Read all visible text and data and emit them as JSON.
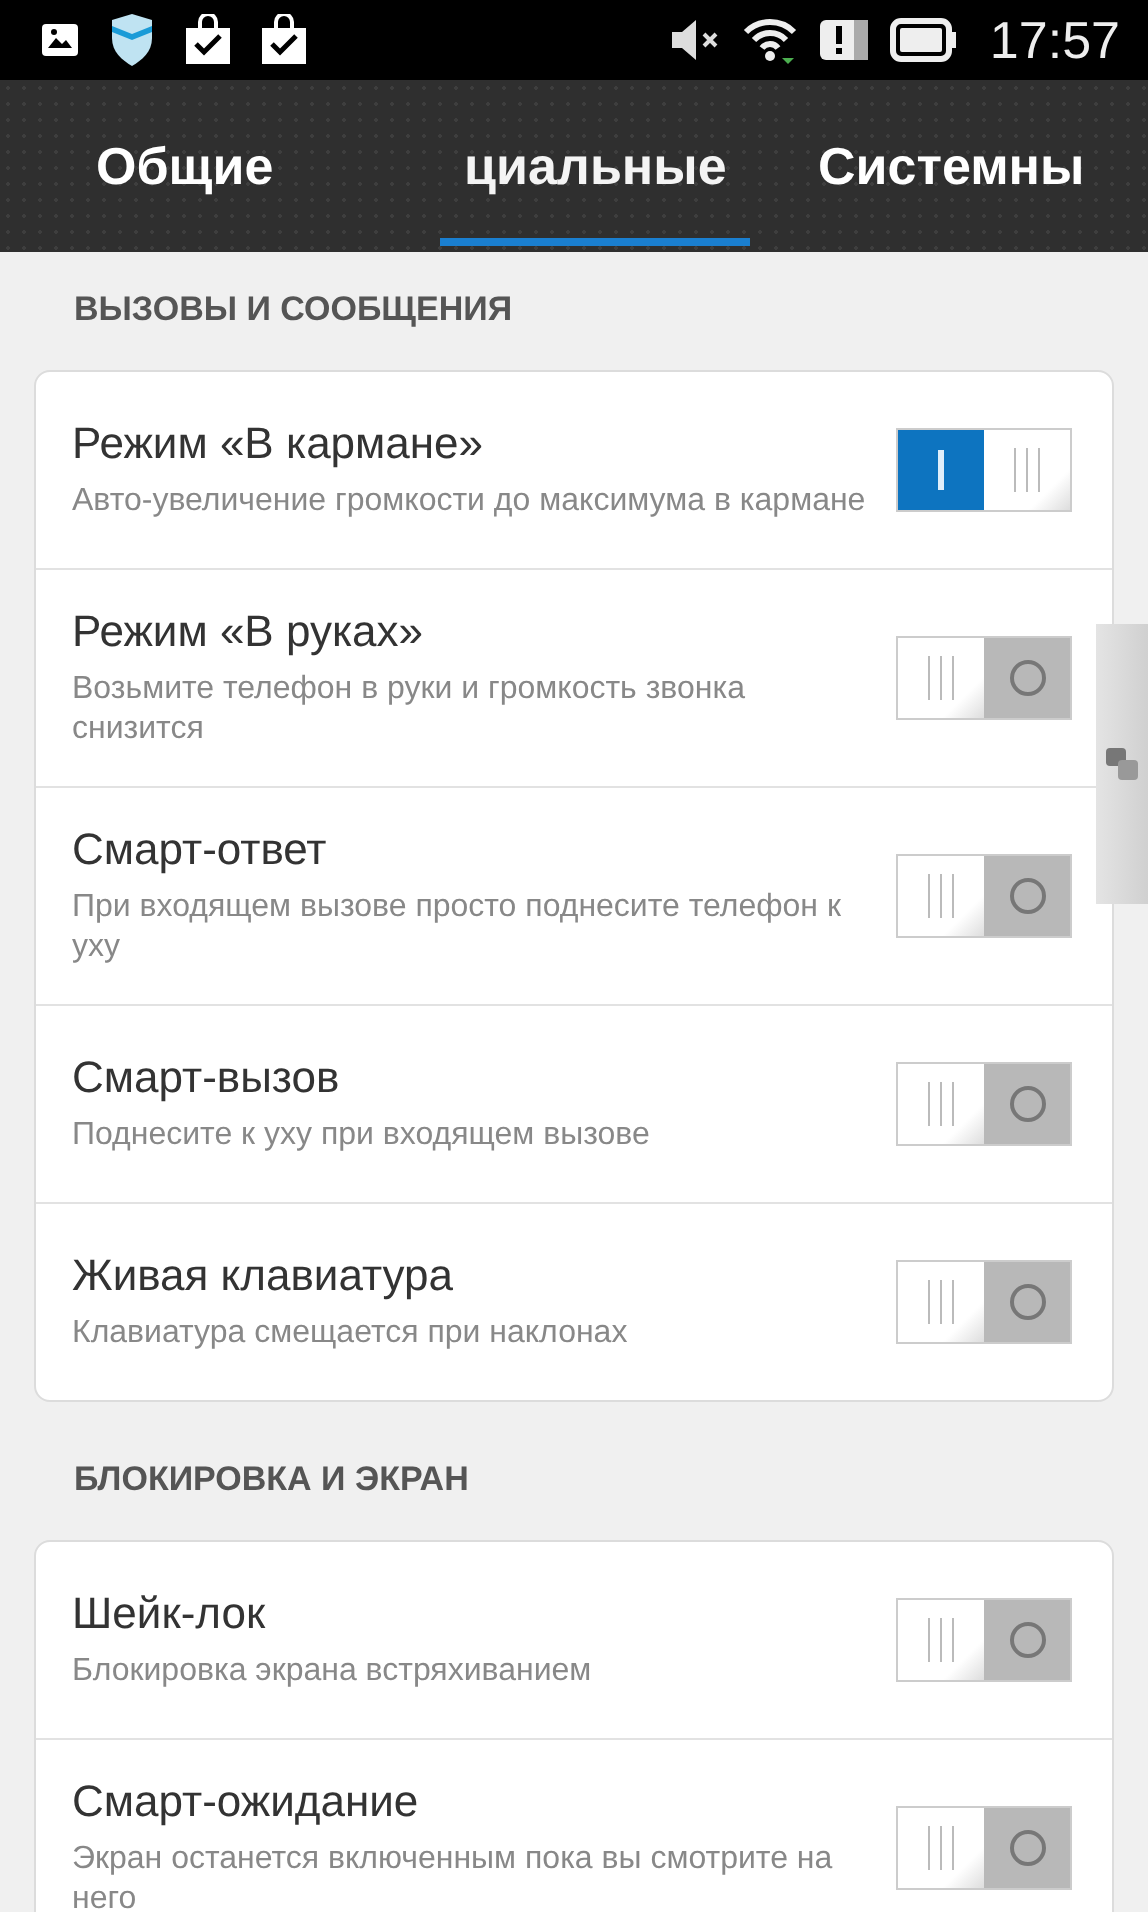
{
  "status_bar": {
    "time": "17:57"
  },
  "tabs": [
    {
      "label": "Общие",
      "selected": false
    },
    {
      "label": "циальные",
      "selected": true
    },
    {
      "label": "Системны",
      "selected": false
    }
  ],
  "sections": [
    {
      "title": "ВЫЗОВЫ И СООБЩЕНИЯ",
      "items": [
        {
          "title": "Режим «В кармане»",
          "subtitle": "Авто-увеличение громкости до максимума в кармане",
          "on": true
        },
        {
          "title": "Режим «В руках»",
          "subtitle": "Возьмите телефон в руки и громкость звонка снизится",
          "on": false
        },
        {
          "title": "Смарт-ответ",
          "subtitle": "При входящем вызове просто поднесите телефон к уху",
          "on": false
        },
        {
          "title": "Смарт-вызов",
          "subtitle": "Поднесите к уху при входящем вызове",
          "on": false
        },
        {
          "title": "Живая клавиатура",
          "subtitle": "Клавиатура смещается при наклонах",
          "on": false
        }
      ]
    },
    {
      "title": "БЛОКИРОВКА И ЭКРАН",
      "items": [
        {
          "title": "Шейк-лок",
          "subtitle": "Блокировка экрана встряхиванием",
          "on": false
        },
        {
          "title": "Смарт-ожидание",
          "subtitle": "Экран останется включенным пока вы смотрите на него",
          "on": false
        }
      ]
    }
  ]
}
